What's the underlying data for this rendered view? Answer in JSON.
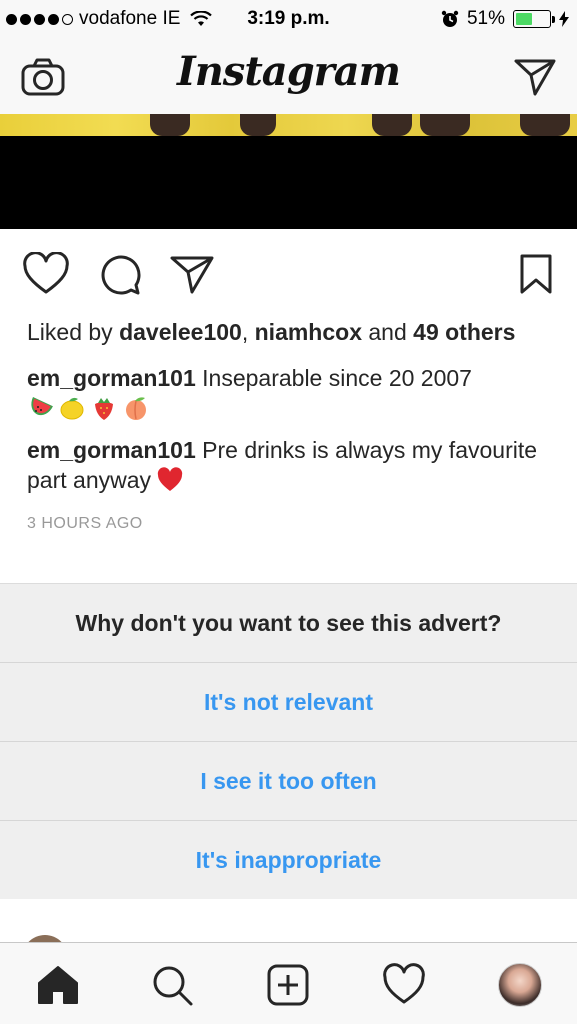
{
  "status_bar": {
    "carrier": "vodafone IE",
    "time": "3:19 p.m.",
    "battery_percent_text": "51%",
    "battery_level": 0.51,
    "signal_bars_filled": 4,
    "signal_bars_total": 5,
    "battery_color": "#4cd964"
  },
  "header": {
    "logo_text": "Instagram",
    "left_icon": "camera-icon",
    "right_icon": "direct-send-icon"
  },
  "post": {
    "likes": {
      "prefix": "Liked by ",
      "user1": "davelee100",
      "separator": ", ",
      "user2": "niamhcox",
      "and": " and ",
      "others": "49 others"
    },
    "comments": [
      {
        "user": "em_gorman101",
        "text": " Inseparable since 20 2007",
        "emojis": [
          "watermelon-emoji",
          "lemon-emoji",
          "strawberry-emoji",
          "peach-emoji"
        ]
      },
      {
        "user": "em_gorman101",
        "text": " Pre drinks is always my favourite part anyway ",
        "emojis": [
          "red-heart-emoji"
        ]
      }
    ],
    "time_ago": "3 HOURS AGO"
  },
  "ad_feedback": {
    "question": "Why don't you want to see this advert?",
    "options": [
      "It's not relevant",
      "I see it too often",
      "It's inappropriate"
    ],
    "option_color": "#3897f0"
  },
  "tab_bar": {
    "items": [
      "home-icon",
      "search-icon",
      "add-post-icon",
      "activity-heart-icon",
      "profile-avatar"
    ],
    "active": "home-icon"
  }
}
